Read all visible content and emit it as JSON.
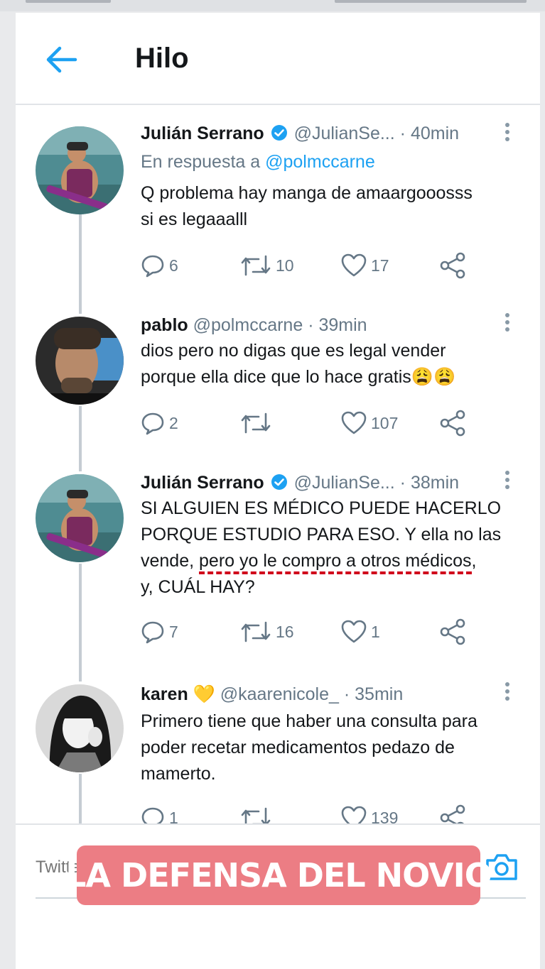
{
  "header": {
    "title": "Hilo"
  },
  "tweets": [
    {
      "name": "Julián Serrano",
      "verified": true,
      "handle": "@JulianSe...",
      "separator": "·",
      "time": "40min",
      "reply_prefix": "En respuesta a ",
      "reply_mention": "@polmccarne",
      "text_lines": [
        "Q problema hay manga de amaargooosss",
        "si es legaaalll"
      ],
      "replies": "6",
      "retweets": "10",
      "likes": "17"
    },
    {
      "name": "pablo",
      "verified": false,
      "handle": "@polmccarne",
      "separator": "·",
      "time": "39min",
      "text_lines": [
        "dios pero no digas que es legal vender",
        "porque ella dice que lo hace gratis😩😩"
      ],
      "replies": "2",
      "retweets": "",
      "likes": "107"
    },
    {
      "name": "Julián Serrano",
      "verified": true,
      "handle": "@JulianSe...",
      "separator": "·",
      "time": "38min",
      "text_line1": "SI ALGUIEN ES MÉDICO PUEDE HACERLO",
      "text_line2": "PORQUE ESTUDIO PARA ESO. Y ella no las",
      "text_line3_plain": "vende, ",
      "text_line3_marked": "pero yo le compro a otros médicos",
      "text_line3_end": ",",
      "text_line4": "y, CUÁL HAY?",
      "replies": "7",
      "retweets": "16",
      "likes": "1"
    },
    {
      "name": "karen",
      "name_emoji": "💛",
      "verified": false,
      "handle": "@kaarenicole_",
      "separator": "·",
      "time": "35min",
      "text_lines": [
        "Primero tiene que haber una consulta para",
        "poder recetar medicamentos pedazo de",
        "mamerto."
      ],
      "replies": "1",
      "retweets": "",
      "likes": "139"
    }
  ],
  "composer": {
    "placeholder": "Twittea tu respuesta"
  },
  "overlay": {
    "text": "LA DEFENSA DEL NOVIO"
  },
  "colors": {
    "accent": "#1da1f2",
    "underline": "#d0021b",
    "banner": "#ec7d84",
    "muted": "#657786"
  }
}
